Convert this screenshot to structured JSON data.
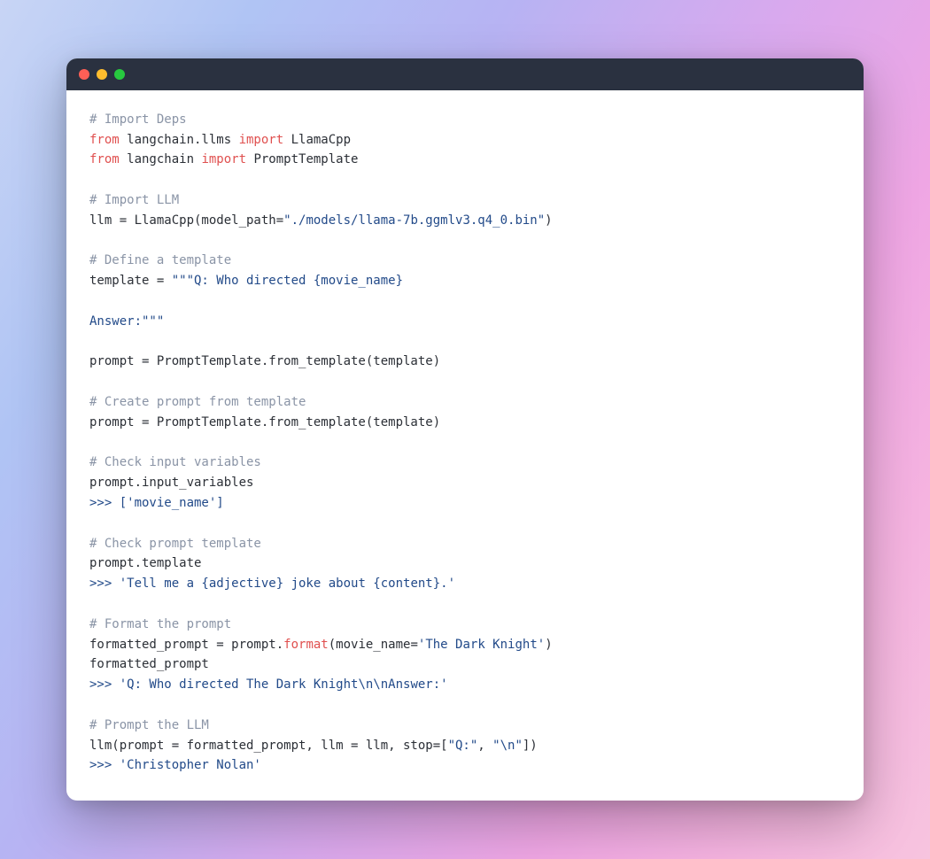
{
  "code_lines": [
    [
      {
        "cls": "tok-comment",
        "t": "# Import Deps"
      }
    ],
    [
      {
        "cls": "tok-keyword",
        "t": "from"
      },
      {
        "cls": "",
        "t": " langchain.llms "
      },
      {
        "cls": "tok-keyword",
        "t": "import"
      },
      {
        "cls": "",
        "t": " LlamaCpp"
      }
    ],
    [
      {
        "cls": "tok-keyword",
        "t": "from"
      },
      {
        "cls": "",
        "t": " langchain "
      },
      {
        "cls": "tok-keyword",
        "t": "import"
      },
      {
        "cls": "",
        "t": " PromptTemplate"
      }
    ],
    [],
    [
      {
        "cls": "tok-comment",
        "t": "# Import LLM"
      }
    ],
    [
      {
        "cls": "",
        "t": "llm = LlamaCpp(model_path="
      },
      {
        "cls": "tok-string",
        "t": "\"./models/llama-7b.ggmlv3.q4_0.bin\""
      },
      {
        "cls": "",
        "t": ")"
      }
    ],
    [],
    [
      {
        "cls": "tok-comment",
        "t": "# Define a template"
      }
    ],
    [
      {
        "cls": "",
        "t": "template = "
      },
      {
        "cls": "tok-string",
        "t": "\"\"\"Q: Who directed {movie_name}"
      }
    ],
    [
      {
        "cls": "tok-string",
        "t": ""
      }
    ],
    [
      {
        "cls": "tok-string",
        "t": "Answer:\"\"\""
      }
    ],
    [],
    [
      {
        "cls": "",
        "t": "prompt = PromptTemplate.from_template(template)"
      }
    ],
    [],
    [
      {
        "cls": "tok-comment",
        "t": "# Create prompt from template"
      }
    ],
    [
      {
        "cls": "",
        "t": "prompt = PromptTemplate.from_template(template)"
      }
    ],
    [],
    [
      {
        "cls": "tok-comment",
        "t": "# Check input variables"
      }
    ],
    [
      {
        "cls": "",
        "t": "prompt.input_variables"
      }
    ],
    [
      {
        "cls": "tok-promptm",
        "t": ">>> "
      },
      {
        "cls": "tok-output",
        "t": "['movie_name']"
      }
    ],
    [],
    [
      {
        "cls": "tok-comment",
        "t": "# Check prompt template"
      }
    ],
    [
      {
        "cls": "",
        "t": "prompt.template"
      }
    ],
    [
      {
        "cls": "tok-promptm",
        "t": ">>> "
      },
      {
        "cls": "tok-output",
        "t": "'Tell me a {adjective} joke about {content}.'"
      }
    ],
    [],
    [
      {
        "cls": "tok-comment",
        "t": "# Format the prompt"
      }
    ],
    [
      {
        "cls": "",
        "t": "formatted_prompt = prompt."
      },
      {
        "cls": "tok-method",
        "t": "format"
      },
      {
        "cls": "",
        "t": "(movie_name="
      },
      {
        "cls": "tok-string",
        "t": "'The Dark Knight'"
      },
      {
        "cls": "",
        "t": ")"
      }
    ],
    [
      {
        "cls": "",
        "t": "formatted_prompt"
      }
    ],
    [
      {
        "cls": "tok-promptm",
        "t": ">>> "
      },
      {
        "cls": "tok-output",
        "t": "'Q: Who directed The Dark Knight\\n\\nAnswer:'"
      }
    ],
    [],
    [
      {
        "cls": "tok-comment",
        "t": "# Prompt the LLM"
      }
    ],
    [
      {
        "cls": "",
        "t": "llm(prompt = formatted_prompt, llm = llm, stop=["
      },
      {
        "cls": "tok-string",
        "t": "\"Q:\""
      },
      {
        "cls": "",
        "t": ", "
      },
      {
        "cls": "tok-string",
        "t": "\"\\n\""
      },
      {
        "cls": "",
        "t": "])"
      }
    ],
    [
      {
        "cls": "tok-promptm",
        "t": ">>> "
      },
      {
        "cls": "tok-output",
        "t": "'Christopher Nolan'"
      }
    ]
  ]
}
